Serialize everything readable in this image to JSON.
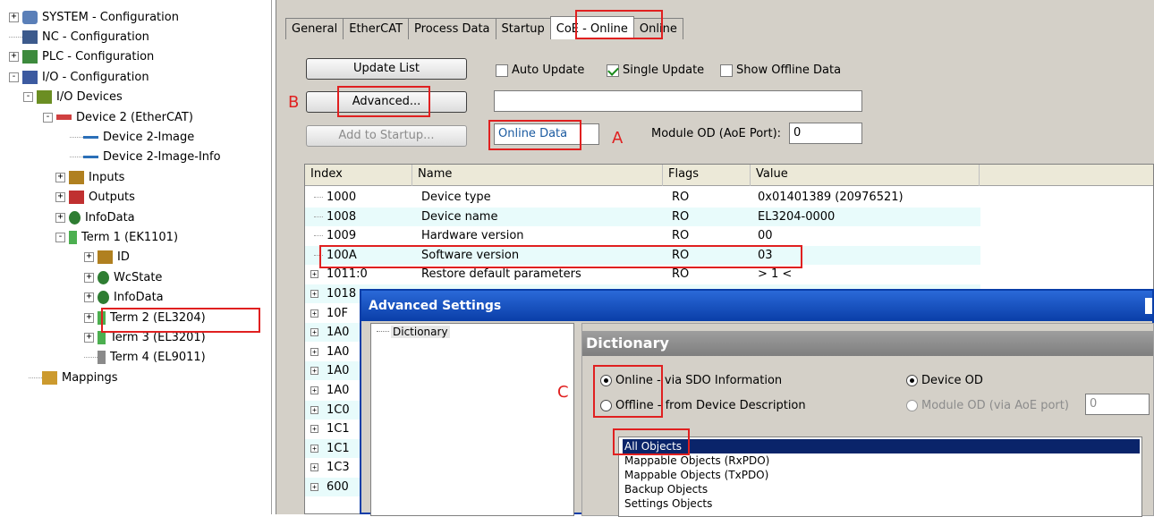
{
  "tree": {
    "items": [
      {
        "label": "SYSTEM - Configuration",
        "icon": "system-icon",
        "exp": "+"
      },
      {
        "label": "NC - Configuration",
        "icon": "nc-icon",
        "exp": ""
      },
      {
        "label": "PLC - Configuration",
        "icon": "plc-icon",
        "exp": "+"
      },
      {
        "label": "I/O - Configuration",
        "icon": "io-config-icon",
        "exp": "-"
      },
      {
        "label": "I/O Devices",
        "icon": "io-devices-icon",
        "exp": "-"
      },
      {
        "label": "Device 2 (EtherCAT)",
        "icon": "ethercat-device-icon",
        "exp": "-"
      },
      {
        "label": "Device 2-Image",
        "icon": "image-icon",
        "exp": ""
      },
      {
        "label": "Device 2-Image-Info",
        "icon": "image-info-icon",
        "exp": ""
      },
      {
        "label": "Inputs",
        "icon": "inputs-icon",
        "exp": "+"
      },
      {
        "label": "Outputs",
        "icon": "outputs-icon",
        "exp": "+"
      },
      {
        "label": "InfoData",
        "icon": "infodata-icon",
        "exp": "+"
      },
      {
        "label": "Term 1 (EK1101)",
        "icon": "terminal-icon",
        "exp": "-"
      },
      {
        "label": "ID",
        "icon": "id-icon",
        "exp": "+"
      },
      {
        "label": "WcState",
        "icon": "wcstate-icon",
        "exp": "+"
      },
      {
        "label": "InfoData",
        "icon": "infodata-icon",
        "exp": "+"
      },
      {
        "label": "Term 2 (EL3204)",
        "icon": "terminal-icon",
        "exp": "+"
      },
      {
        "label": "Term 3 (EL3201)",
        "icon": "terminal-icon",
        "exp": "+"
      },
      {
        "label": "Term 4 (EL9011)",
        "icon": "terminal-end-icon",
        "exp": ""
      },
      {
        "label": "Mappings",
        "icon": "mappings-icon",
        "exp": ""
      }
    ]
  },
  "tabs": [
    "General",
    "EtherCAT",
    "Process Data",
    "Startup",
    "CoE - Online",
    "Online"
  ],
  "active_tab": "CoE - Online",
  "controls": {
    "update_list": "Update List",
    "advanced": "Advanced...",
    "add_to_startup": "Add to Startup...",
    "auto_update": "Auto Update",
    "single_update": "Single Update",
    "show_offline": "Show Offline Data",
    "online_data": "Online Data",
    "module_od_label": "Module OD (AoE Port):",
    "module_od_value": "0",
    "annotation_a": "A",
    "annotation_b": "B",
    "annotation_c": "C"
  },
  "table": {
    "headers": [
      "Index",
      "Name",
      "Flags",
      "Value"
    ],
    "rows": [
      {
        "index": "1000",
        "name": "Device type",
        "flags": "RO",
        "value": "0x01401389 (20976521)",
        "exp": ""
      },
      {
        "index": "1008",
        "name": "Device name",
        "flags": "RO",
        "value": "EL3204-0000",
        "exp": ""
      },
      {
        "index": "1009",
        "name": "Hardware version",
        "flags": "RO",
        "value": "00",
        "exp": ""
      },
      {
        "index": "100A",
        "name": "Software version",
        "flags": "RO",
        "value": "03",
        "exp": ""
      },
      {
        "index": "1011:0",
        "name": "Restore default parameters",
        "flags": "RO",
        "value": "> 1 <",
        "exp": "+"
      },
      {
        "index": "1018",
        "name": "",
        "flags": "",
        "value": "",
        "exp": "+"
      },
      {
        "index": "10F",
        "name": "",
        "flags": "",
        "value": "",
        "exp": "+"
      },
      {
        "index": "1A0",
        "name": "",
        "flags": "",
        "value": "",
        "exp": "+"
      },
      {
        "index": "1A0",
        "name": "",
        "flags": "",
        "value": "",
        "exp": "+"
      },
      {
        "index": "1A0",
        "name": "",
        "flags": "",
        "value": "",
        "exp": "+"
      },
      {
        "index": "1A0",
        "name": "",
        "flags": "",
        "value": "",
        "exp": "+"
      },
      {
        "index": "1C0",
        "name": "",
        "flags": "",
        "value": "",
        "exp": "+"
      },
      {
        "index": "1C1",
        "name": "",
        "flags": "",
        "value": "",
        "exp": "+"
      },
      {
        "index": "1C1",
        "name": "",
        "flags": "",
        "value": "",
        "exp": "+"
      },
      {
        "index": "1C3",
        "name": "",
        "flags": "",
        "value": "",
        "exp": "+"
      },
      {
        "index": "600",
        "name": "",
        "flags": "",
        "value": "",
        "exp": "+"
      }
    ]
  },
  "dialog": {
    "title": "Advanced Settings",
    "tree_item": "Dictionary",
    "section_title": "Dictionary",
    "online_label": "Online - via SDO Information",
    "offline_label": "Offline - from Device Description",
    "device_od": "Device OD",
    "module_od": "Module OD (via AoE port)",
    "module_od_value": "0",
    "list": [
      "All Objects",
      "Mappable Objects (RxPDO)",
      "Mappable Objects (TxPDO)",
      "Backup Objects",
      "Settings Objects"
    ],
    "selected": "All Objects"
  },
  "colors": {
    "highlight": "#e02020",
    "title_bar": "#0a3ea8",
    "row_alt": "#e8fbfb"
  }
}
